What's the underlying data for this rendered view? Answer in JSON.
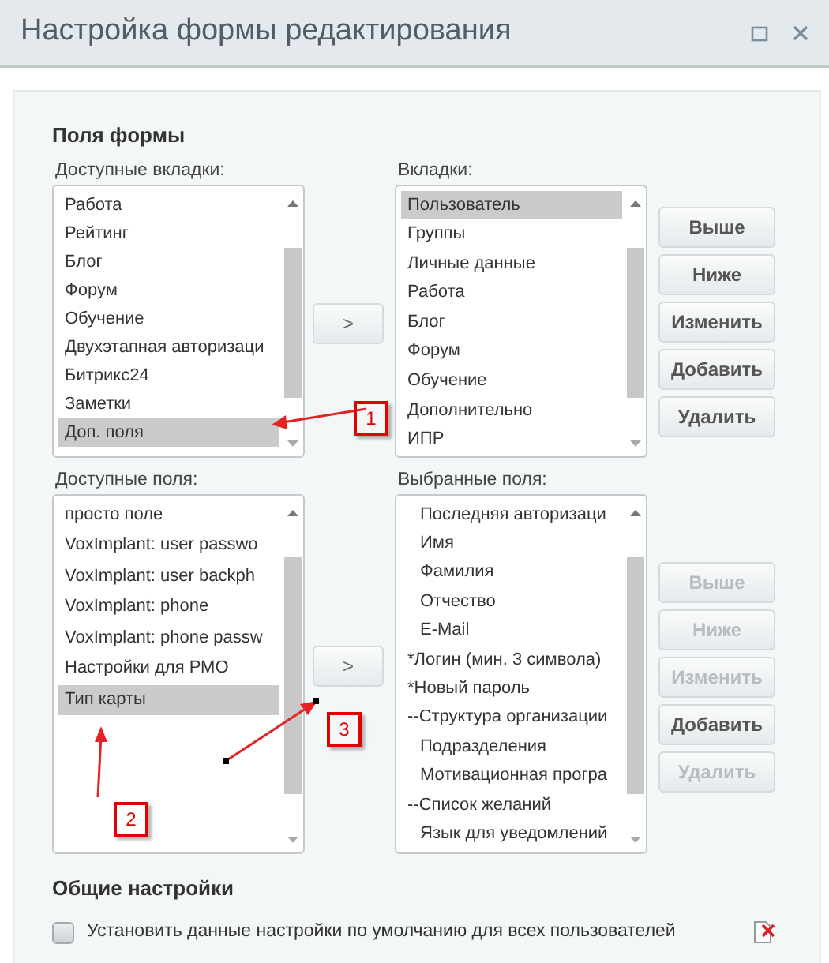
{
  "window": {
    "title": "Настройка формы редактирования"
  },
  "form_fields": {
    "title": "Поля формы",
    "sections": [
      {
        "available": {
          "label": "Доступные вкладки:",
          "items": [
            {
              "text": "Работа",
              "selected": false
            },
            {
              "text": "Рейтинг",
              "selected": false
            },
            {
              "text": "Блог",
              "selected": false
            },
            {
              "text": "Форум",
              "selected": false
            },
            {
              "text": "Обучение",
              "selected": false
            },
            {
              "text": "Двухэтапная авторизаци",
              "selected": false
            },
            {
              "text": "Битрикс24",
              "selected": false
            },
            {
              "text": "Заметки",
              "selected": false
            },
            {
              "text": "Доп. поля",
              "selected": true
            }
          ]
        },
        "move_button": ">",
        "chosen": {
          "label": "Вкладки:",
          "items": [
            {
              "text": "Пользователь",
              "selected": true,
              "kind": "plain"
            },
            {
              "text": "Группы",
              "selected": false,
              "kind": "plain"
            },
            {
              "text": "Личные данные",
              "selected": false,
              "kind": "plain"
            },
            {
              "text": "Работа",
              "selected": false,
              "kind": "plain"
            },
            {
              "text": "Блог",
              "selected": false,
              "kind": "plain"
            },
            {
              "text": "Форум",
              "selected": false,
              "kind": "plain"
            },
            {
              "text": "Обучение",
              "selected": false,
              "kind": "plain"
            },
            {
              "text": "Дополнительно",
              "selected": false,
              "kind": "plain"
            },
            {
              "text": "ИПР",
              "selected": false,
              "kind": "plain"
            }
          ]
        },
        "buttons": [
          {
            "label": "Выше",
            "disabled": false
          },
          {
            "label": "Ниже",
            "disabled": false
          },
          {
            "label": "Изменить",
            "disabled": false
          },
          {
            "label": "Добавить",
            "disabled": false
          },
          {
            "label": "Удалить",
            "disabled": false
          }
        ]
      },
      {
        "available": {
          "label": "Доступные поля:",
          "items": [
            {
              "text": "просто поле",
              "selected": false
            },
            {
              "text": "VoxImplant: user passwo",
              "selected": false
            },
            {
              "text": "VoxImplant: user backph",
              "selected": false
            },
            {
              "text": "VoxImplant: phone",
              "selected": false
            },
            {
              "text": "VoxImplant: phone passw",
              "selected": false
            },
            {
              "text": "Настройки для РМО",
              "selected": false
            },
            {
              "text": "Тип карты",
              "selected": true
            }
          ]
        },
        "move_button": ">",
        "chosen": {
          "label": "Выбранные поля:",
          "items": [
            {
              "text": "Последняя авторизаци",
              "selected": false,
              "kind": "field"
            },
            {
              "text": "Имя",
              "selected": false,
              "kind": "field"
            },
            {
              "text": "Фамилия",
              "selected": false,
              "kind": "field"
            },
            {
              "text": "Отчество",
              "selected": false,
              "kind": "field"
            },
            {
              "text": "E-Mail",
              "selected": false,
              "kind": "field"
            },
            {
              "text": "*Логин (мин. 3 символа)",
              "selected": false,
              "kind": "plain"
            },
            {
              "text": "*Новый пароль",
              "selected": false,
              "kind": "plain"
            },
            {
              "text": "--Структура организации",
              "selected": false,
              "kind": "plain"
            },
            {
              "text": "Подразделения",
              "selected": false,
              "kind": "field"
            },
            {
              "text": "Мотивационная програ",
              "selected": false,
              "kind": "field"
            },
            {
              "text": "--Список желаний",
              "selected": false,
              "kind": "plain"
            },
            {
              "text": "Язык для уведомлений",
              "selected": false,
              "kind": "field"
            }
          ]
        },
        "buttons": [
          {
            "label": "Выше",
            "disabled": true
          },
          {
            "label": "Ниже",
            "disabled": true
          },
          {
            "label": "Изменить",
            "disabled": true
          },
          {
            "label": "Добавить",
            "disabled": false
          },
          {
            "label": "Удалить",
            "disabled": true
          }
        ]
      }
    ]
  },
  "general_settings": {
    "title": "Общие настройки",
    "checkbox": {
      "label": "Установить данные настройки по умолчанию для всех пользователей",
      "checked": false
    }
  },
  "annotations": [
    {
      "number": "1"
    },
    {
      "number": "2"
    },
    {
      "number": "3"
    }
  ]
}
